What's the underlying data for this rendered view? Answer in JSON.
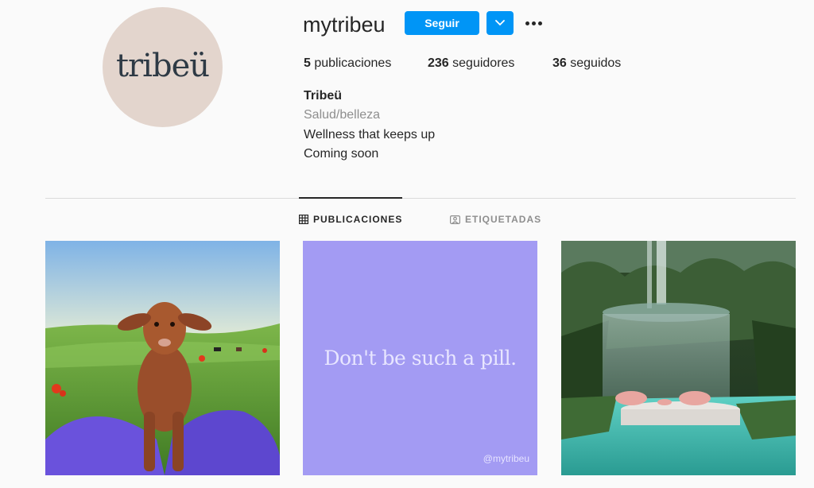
{
  "profile": {
    "username": "mytribeu",
    "avatar_text": "tribeü",
    "follow_label": "Seguir",
    "stats": {
      "posts_count": "5",
      "posts_label": "publicaciones",
      "followers_count": "236",
      "followers_label": "seguidores",
      "following_count": "36",
      "following_label": "seguidos"
    },
    "bio": {
      "name": "Tribeü",
      "category": "Salud/belleza",
      "line1": "Wellness that keeps up",
      "line2": "Coming soon"
    }
  },
  "tabs": [
    {
      "label": "PUBLICACIONES",
      "icon": "grid-icon",
      "active": true
    },
    {
      "label": "ETIQUETADAS",
      "icon": "tag-icon",
      "active": false
    }
  ],
  "posts": [
    {
      "description_icon": "lamb-photo"
    },
    {
      "text": "Don't be such a pill.",
      "handle": "@mytribeu",
      "bg": "#a39bf3"
    },
    {
      "description_icon": "forest-pool-photo"
    }
  ],
  "colors": {
    "accent": "#0095f6",
    "text": "#262626",
    "muted": "#8e8e8e",
    "avatar_bg": "#e3d5cd"
  }
}
